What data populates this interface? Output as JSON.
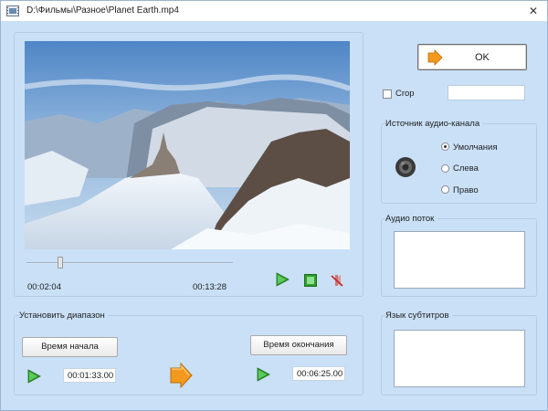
{
  "window": {
    "title": "D:\\Фильмы\\Разное\\Planet Earth.mp4",
    "close_glyph": "✕"
  },
  "player": {
    "current_time": "00:02:04",
    "total_time": "00:13:28",
    "position_fraction": 0.15,
    "controls": [
      "play-icon",
      "stop-icon",
      "mute-icon"
    ]
  },
  "range": {
    "title": "Установить диапазон",
    "start_button": "Время начала",
    "end_button": "Время окончания",
    "start_value": "00:01:33.00",
    "end_value": "00:06:25.00"
  },
  "ok_button": "OK",
  "crop": {
    "label": "Crop",
    "checked": false,
    "value": ""
  },
  "audio_channel": {
    "title": "Источник аудио-канала",
    "options": [
      "Умолчания",
      "Слева",
      "Право"
    ],
    "selected": "Умолчания"
  },
  "audio_stream": {
    "title": "Аудио поток"
  },
  "subtitle_lang": {
    "title": "Язык субтитров"
  },
  "colors": {
    "window_bg": "#c9e0f7",
    "accent_green": "#2e9e2e",
    "accent_orange": "#f39a1e"
  }
}
